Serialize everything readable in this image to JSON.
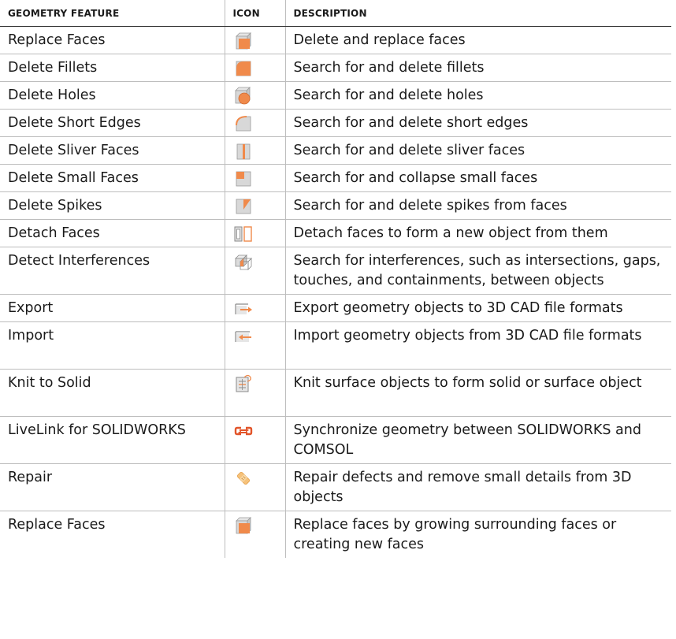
{
  "headers": {
    "feature": "GEOMETRY FEATURE",
    "icon": "ICON",
    "description": "DESCRIPTION"
  },
  "rows": [
    {
      "feature": "Replace Faces",
      "icon": "replace-faces-icon",
      "description": "Delete and replace faces"
    },
    {
      "feature": "Delete Fillets",
      "icon": "delete-fillets-icon",
      "description": "Search for and delete fillets"
    },
    {
      "feature": "Delete Holes",
      "icon": "delete-holes-icon",
      "description": "Search for and delete holes"
    },
    {
      "feature": "Delete Short Edges",
      "icon": "delete-short-edges-icon",
      "description": "Search for and delete short edges"
    },
    {
      "feature": "Delete Sliver Faces",
      "icon": "delete-sliver-faces-icon",
      "description": "Search for and delete sliver faces"
    },
    {
      "feature": "Delete Small Faces",
      "icon": "delete-small-faces-icon",
      "description": "Search for and collapse small faces"
    },
    {
      "feature": "Delete Spikes",
      "icon": "delete-spikes-icon",
      "description": "Search for and delete spikes from faces"
    },
    {
      "feature": "Detach Faces",
      "icon": "detach-faces-icon",
      "description": "Detach faces to form a new object from them"
    },
    {
      "feature": "Detect Interferences",
      "icon": "detect-interferences-icon",
      "description": "Search for interferences, such as intersections, gaps, touches, and containments, between objects"
    },
    {
      "feature": "Export",
      "icon": "export-icon",
      "description": "Export geometry objects to 3D CAD file formats"
    },
    {
      "feature": "Import",
      "icon": "import-icon",
      "description": "Import geometry objects from 3D CAD file formats"
    },
    {
      "feature": "Knit to Solid",
      "icon": "knit-to-solid-icon",
      "description": "Knit surface objects to form solid or surface object"
    },
    {
      "feature": "LiveLink for SOLIDWORKS",
      "icon": "livelink-icon",
      "description": "Synchronize geometry between SOLIDWORKS and COMSOL"
    },
    {
      "feature": "Repair",
      "icon": "repair-icon",
      "description": "Repair defects and remove small details from 3D objects"
    },
    {
      "feature": "Replace Faces",
      "icon": "replace-faces-icon",
      "description": "Replace faces by growing surrounding faces or creating new faces"
    }
  ],
  "colors": {
    "accent": "#f08a4b",
    "accent_light": "#f6b488",
    "icon_gray": "#d3d3d3",
    "icon_stroke": "#9a9a9a",
    "rule": "#bdbdbd"
  }
}
